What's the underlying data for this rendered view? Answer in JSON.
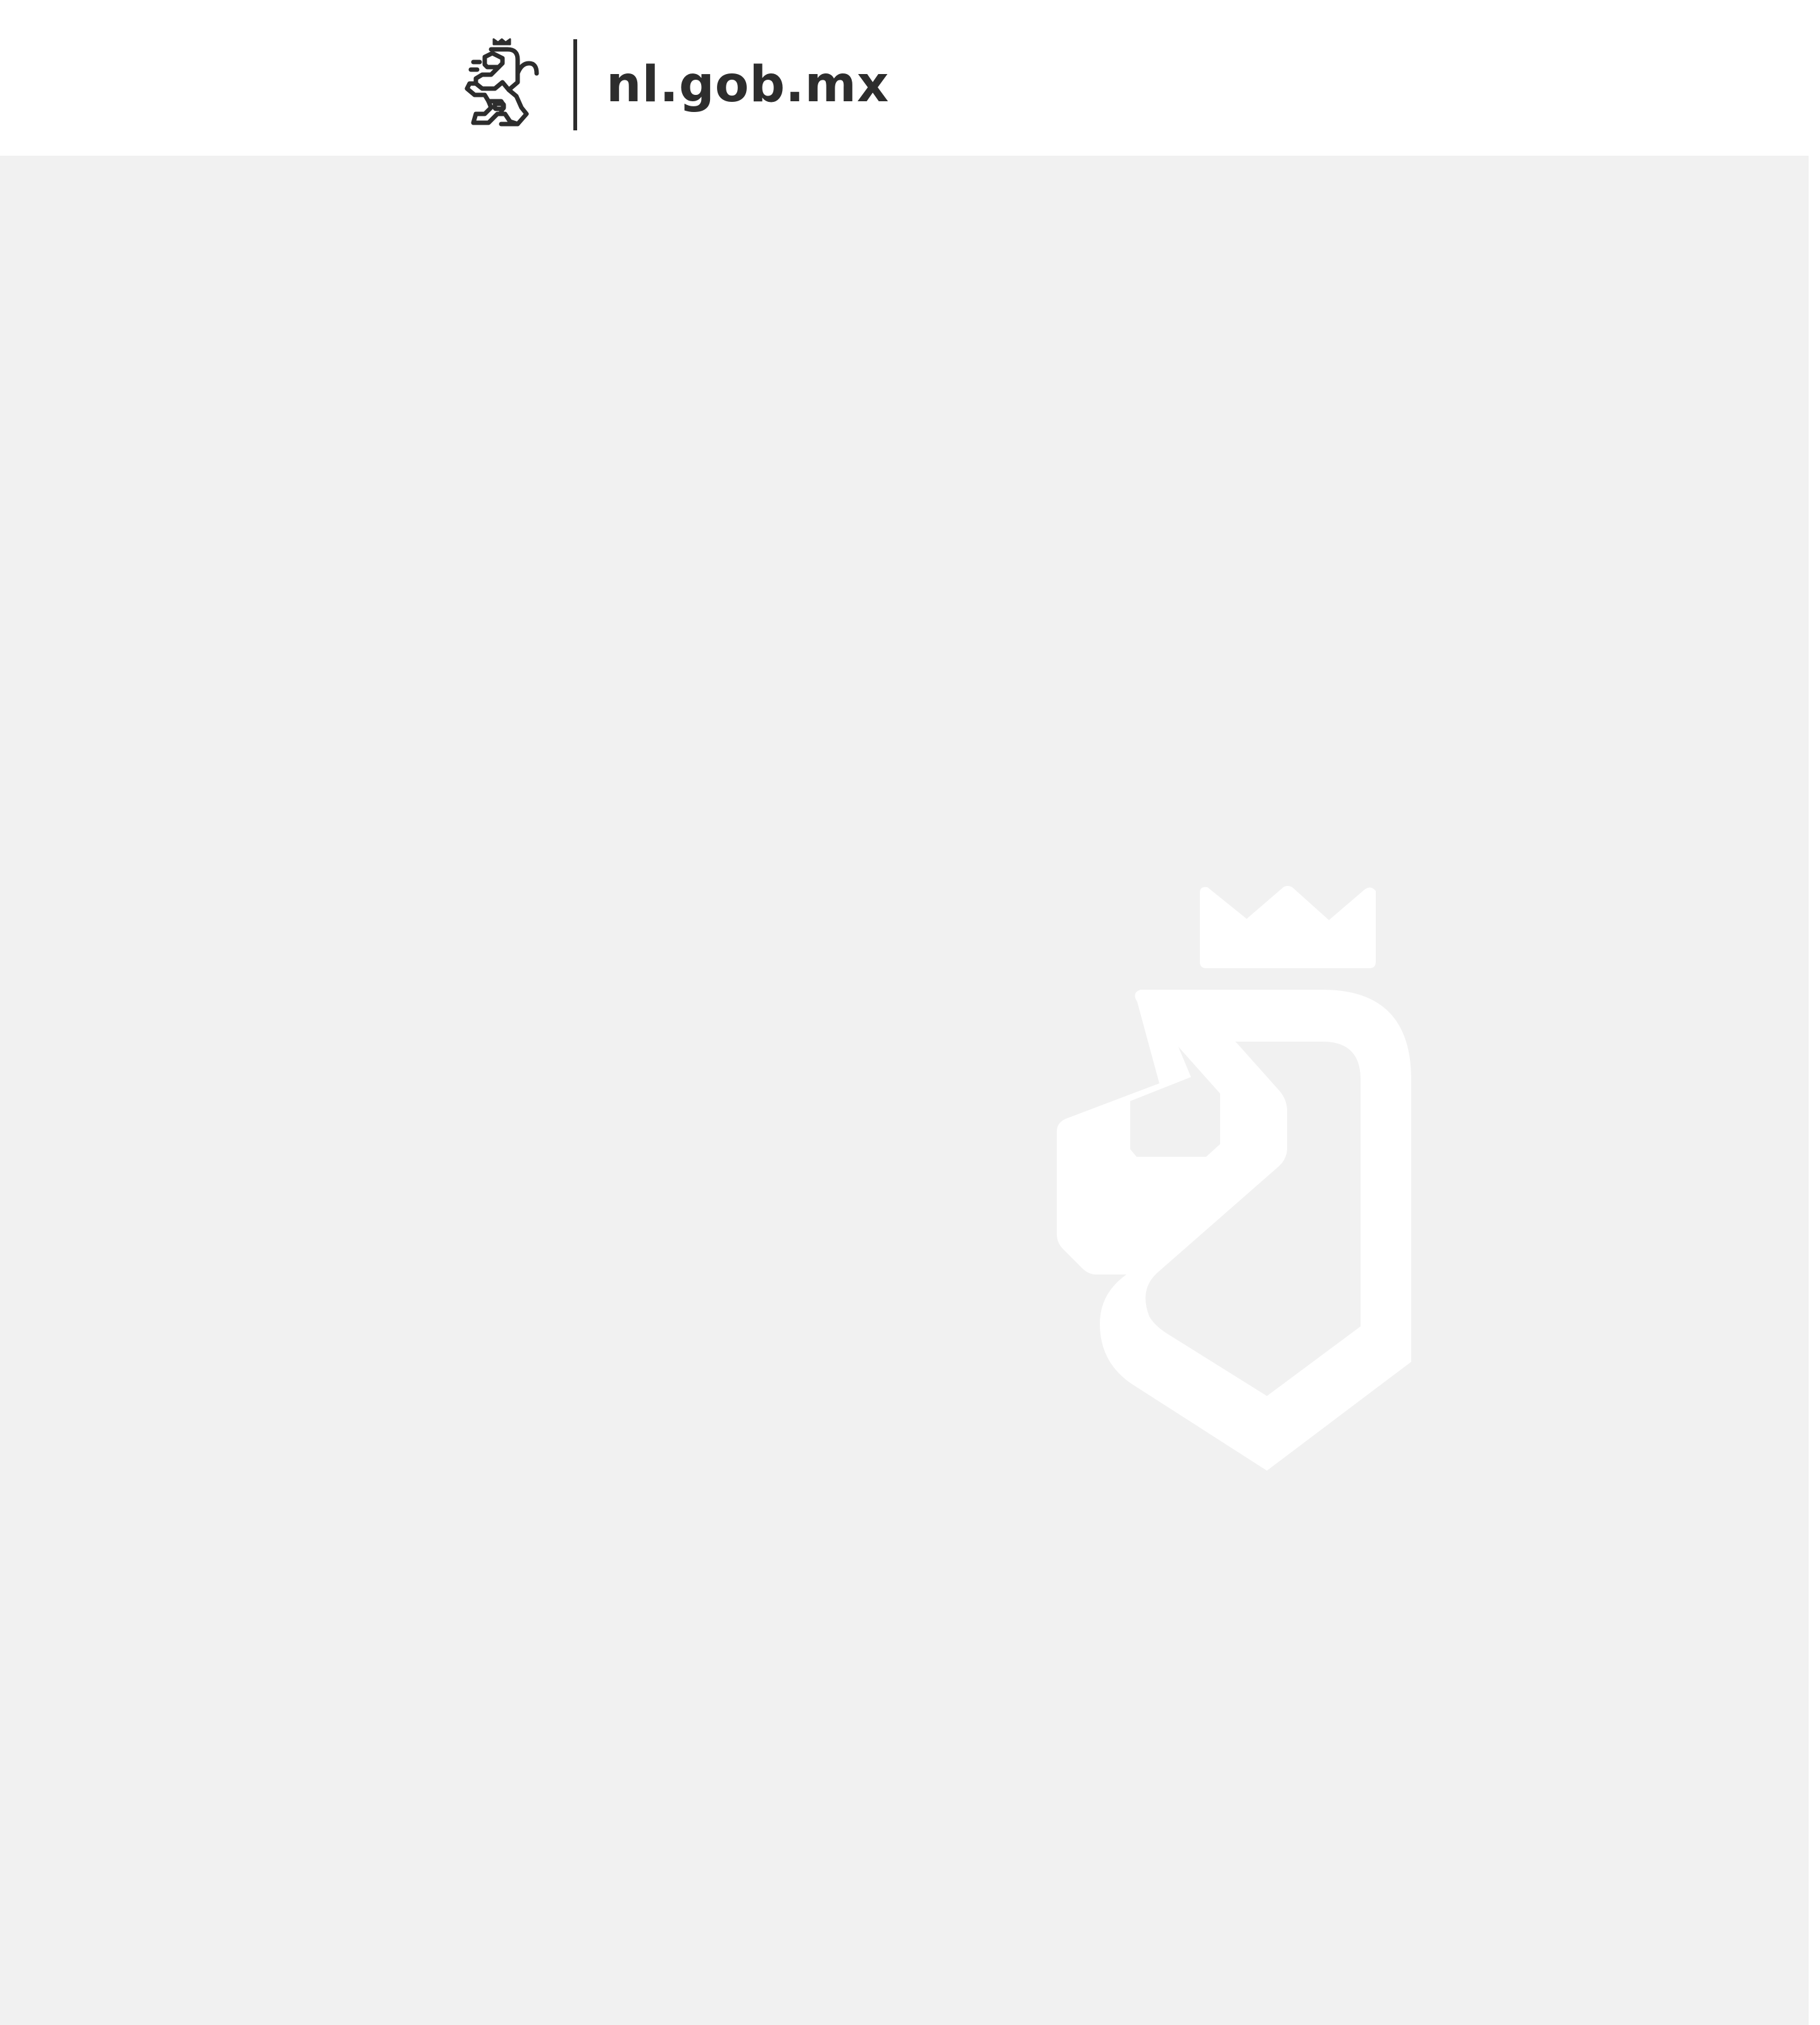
{
  "header": {
    "site_name": "nl.gob.mx",
    "logo_icon": "lion-crest-icon"
  },
  "main": {
    "loading_icon": "lion-crest-icon"
  },
  "colors": {
    "header_background": "#ffffff",
    "brand_text": "#2d2d2d",
    "main_background": "#f1f1f1",
    "loader_icon": "#ffffff"
  }
}
